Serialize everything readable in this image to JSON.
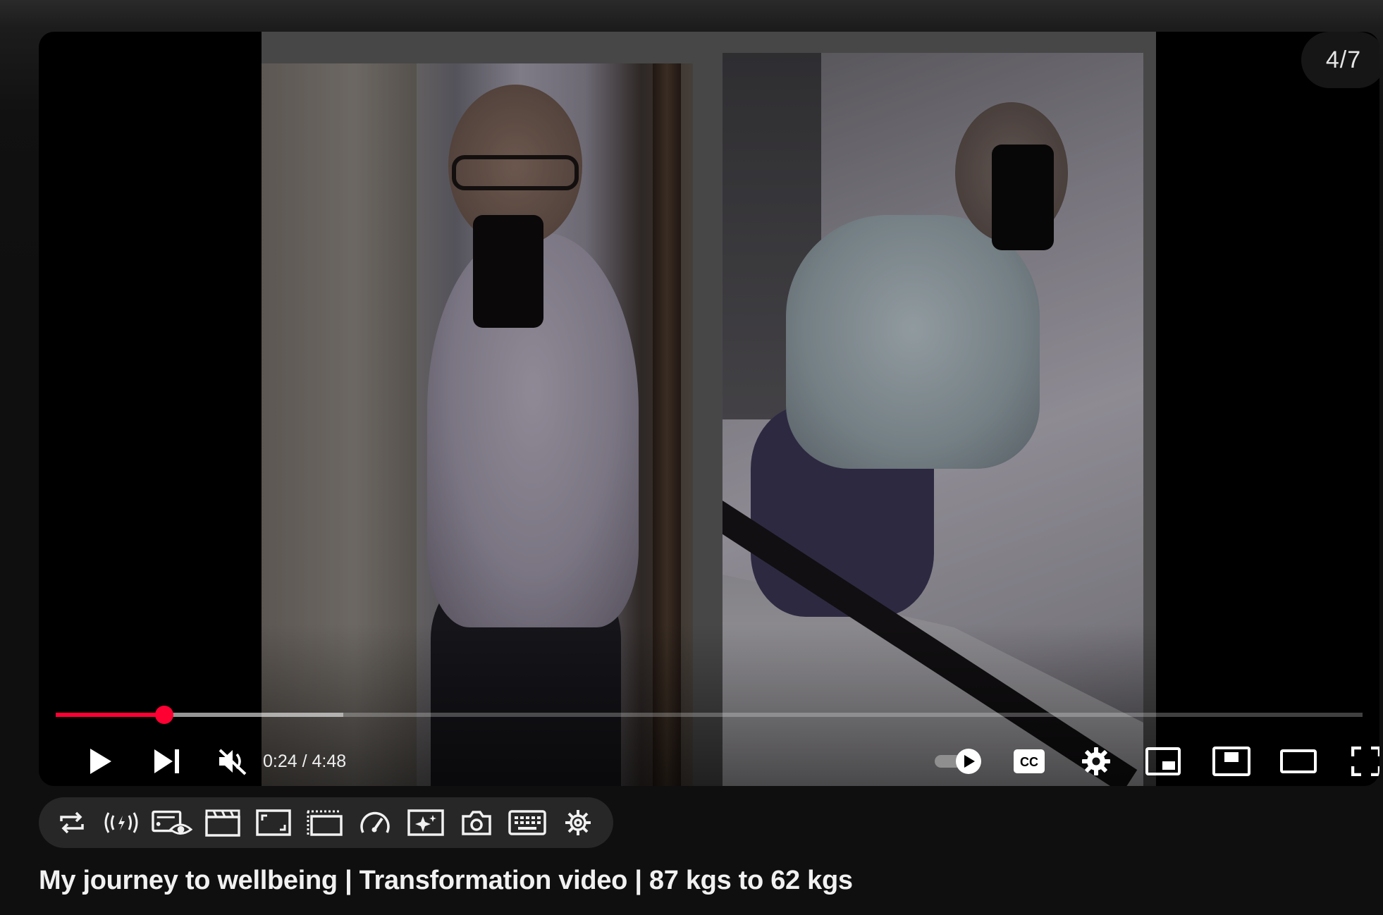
{
  "player": {
    "slide_counter": "4/7",
    "time_current": "0:24",
    "time_separator": " / ",
    "time_duration": "4:48",
    "progress_played_fraction": 0.0833,
    "progress_buffered_fraction": 0.22,
    "muted": true,
    "autoplay_on": true,
    "accent_color": "#ff0033",
    "controls_left": [
      "play-icon",
      "next-icon",
      "mute-icon"
    ],
    "controls_right": [
      "autoplay-toggle-icon",
      "closed-captions-icon",
      "settings-gear-icon",
      "miniplayer-icon",
      "picture-in-picture-icon",
      "theater-mode-icon",
      "fullscreen-icon"
    ],
    "cc_label": "CC"
  },
  "toolbar": {
    "tools": [
      "loop-icon",
      "broadcast-icon",
      "watched-eye-icon",
      "clapperboard-icon",
      "expand-frame-icon",
      "mini-screen-icon",
      "speedometer-icon",
      "sparkle-frame-icon",
      "camera-icon",
      "keyboard-icon",
      "settings-gear-icon"
    ]
  },
  "video": {
    "title": "My journey to wellbeing | Transformation video | 87 kgs to 62 kgs"
  }
}
